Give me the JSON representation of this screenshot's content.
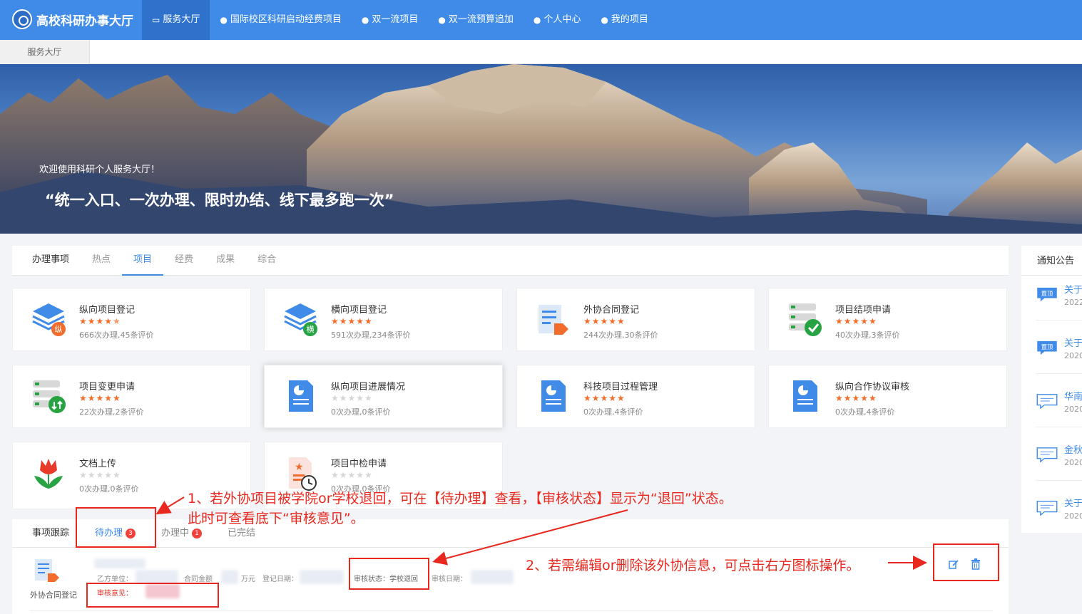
{
  "header": {
    "logo_text": "高校科研办事大厅",
    "nav": [
      {
        "label": "服务大厅",
        "icon": "monitor-icon",
        "active": true
      },
      {
        "label": "国际校区科研启动经费项目",
        "icon": "user-icon"
      },
      {
        "label": "双一流项目",
        "icon": "user-icon"
      },
      {
        "label": "双一流预算追加",
        "icon": "user-icon"
      },
      {
        "label": "个人中心",
        "icon": "user-icon"
      },
      {
        "label": "我的项目",
        "icon": "user-icon"
      }
    ]
  },
  "breadcrumb": "服务大厅",
  "banner": {
    "subtitle": "欢迎使用科研个人服务大厅！",
    "title": "“统一入口、一次办理、限时办结、线下最多跑一次”"
  },
  "service_panel": {
    "tabs": [
      "办理事项",
      "热点",
      "项目",
      "经费",
      "成果",
      "综合"
    ],
    "active_tab": "项目",
    "cards": [
      {
        "name": "纵向项目登记",
        "stars": 4.5,
        "stats": "666次办理,45条评价",
        "icon": "layers-icon",
        "tag": "纵"
      },
      {
        "name": "横向项目登记",
        "stars": 5,
        "stats": "591次办理,234条评价",
        "icon": "layers-icon",
        "tag": "横"
      },
      {
        "name": "外协合同登记",
        "stars": 5,
        "stats": "244次办理,30条评价",
        "icon": "contract-icon"
      },
      {
        "name": "项目结项申请",
        "stars": 5,
        "stats": "40次办理,3条评价",
        "icon": "server-check-icon"
      },
      {
        "name": "项目变更申请",
        "stars": 5,
        "stats": "22次办理,2条评价",
        "icon": "server-sync-icon"
      },
      {
        "name": "纵向项目进展情况",
        "stars": 0,
        "stats": "0次办理,0条评价",
        "icon": "report-icon"
      },
      {
        "name": "科技项目过程管理",
        "stars": 5,
        "stats": "0次办理,4条评价",
        "icon": "report-icon"
      },
      {
        "name": "纵向合作协议审核",
        "stars": 5,
        "stats": "0次办理,4条评价",
        "icon": "report-icon"
      },
      {
        "name": "文档上传",
        "stars": 0,
        "stats": "0次办理,0条评价",
        "icon": "tulip-icon"
      },
      {
        "name": "项目中检申请",
        "stars": 0,
        "stats": "0次办理,0条评价",
        "icon": "doc-clock-icon"
      }
    ]
  },
  "notice": {
    "title": "通知公告",
    "items": [
      {
        "tag": "置顶",
        "title": "关于",
        "date": "2022"
      },
      {
        "tag": "置顶",
        "title": "关于",
        "date": "2020"
      },
      {
        "tag": "",
        "title": "华南",
        "date": "2020"
      },
      {
        "tag": "",
        "title": "金秋",
        "date": "2020"
      },
      {
        "tag": "",
        "title": "关于",
        "date": "2020"
      }
    ]
  },
  "tracking": {
    "tabs": [
      {
        "label": "事项跟踪"
      },
      {
        "label": "待办理",
        "count": "3"
      },
      {
        "label": "办理中",
        "count": "1"
      },
      {
        "label": "已完结"
      }
    ],
    "row": {
      "icon_label": "外协合同登记",
      "party_b_label": "乙方单位：",
      "amount_label": "合同金额",
      "amount_unit": "万元",
      "reg_date_label": "登记日期：",
      "status": "审核状态：学校退回",
      "review_date_label": "审核日期：",
      "opinion_label": "审核意见："
    }
  },
  "annotations": {
    "note1_line1": "1、若外协项目被学院or学校退回，可在【待办理】查看，【审核状态】显示为“退回”状态。",
    "note1_line2": "此时可查看底下“审核意见”。",
    "note2": "2、若需编辑or删除该外协信息，可点击右方图标操作。"
  },
  "colors": {
    "primary": "#3f8be7",
    "star": "#f26c2c",
    "badge": "#f2413a",
    "annotation": "#e8281e"
  }
}
